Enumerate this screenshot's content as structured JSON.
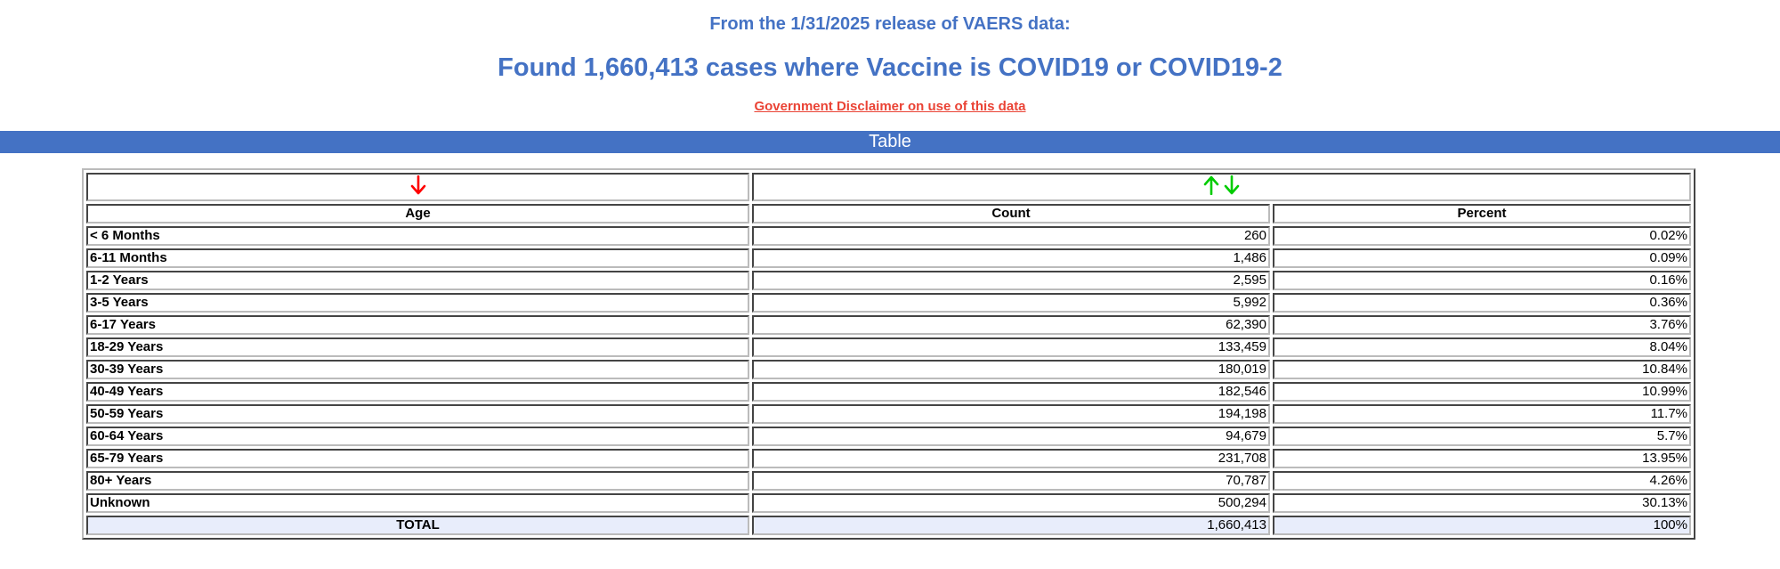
{
  "header": {
    "release": "From the 1/31/2025 release of VAERS data:",
    "found": "Found 1,660,413 cases where Vaccine is COVID19 or COVID19-2",
    "disclaimer": "Government Disclaimer on use of this data"
  },
  "bar": {
    "title": "Table"
  },
  "colors": {
    "accent": "#4472c4",
    "link": "#ea4335",
    "sort_down_active": "#ff0000",
    "sort_arrows": "#00cc00",
    "total_row_bg": "#e8edfb"
  },
  "table": {
    "columns": [
      "Age",
      "Count",
      "Percent"
    ],
    "rows": [
      {
        "age": "< 6 Months",
        "count": "260",
        "percent": "0.02%"
      },
      {
        "age": "6-11 Months",
        "count": "1,486",
        "percent": "0.09%"
      },
      {
        "age": "1-2 Years",
        "count": "2,595",
        "percent": "0.16%"
      },
      {
        "age": "3-5 Years",
        "count": "5,992",
        "percent": "0.36%"
      },
      {
        "age": "6-17 Years",
        "count": "62,390",
        "percent": "3.76%"
      },
      {
        "age": "18-29 Years",
        "count": "133,459",
        "percent": "8.04%"
      },
      {
        "age": "30-39 Years",
        "count": "180,019",
        "percent": "10.84%"
      },
      {
        "age": "40-49 Years",
        "count": "182,546",
        "percent": "10.99%"
      },
      {
        "age": "50-59 Years",
        "count": "194,198",
        "percent": "11.7%"
      },
      {
        "age": "60-64 Years",
        "count": "94,679",
        "percent": "5.7%"
      },
      {
        "age": "65-79 Years",
        "count": "231,708",
        "percent": "13.95%"
      },
      {
        "age": "80+ Years",
        "count": "70,787",
        "percent": "4.26%"
      },
      {
        "age": "Unknown",
        "count": "500,294",
        "percent": "30.13%"
      }
    ],
    "total": {
      "label": "TOTAL",
      "count": "1,660,413",
      "percent": "100%"
    }
  },
  "icons": {
    "age_sort": "arrow-down-icon",
    "count_sort_up": "arrow-up-icon",
    "count_sort_down": "arrow-down-icon"
  }
}
